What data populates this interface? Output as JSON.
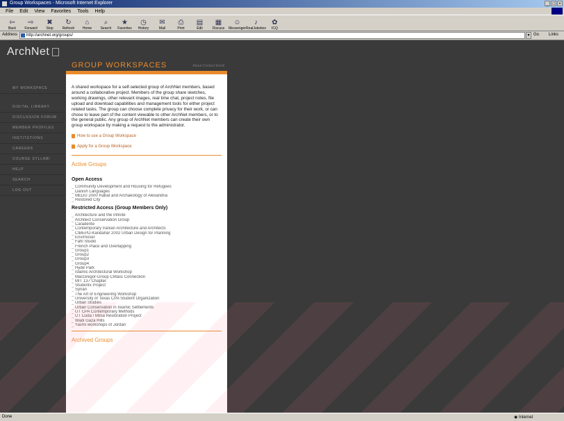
{
  "window": {
    "title": "Group Workspaces - Microsoft Internet Explorer",
    "menus": [
      "File",
      "Edit",
      "View",
      "Favorites",
      "Tools",
      "Help"
    ]
  },
  "toolbar": {
    "buttons": [
      {
        "label": "Back",
        "icon": "back-arrow-icon"
      },
      {
        "label": "Forward",
        "icon": "forward-arrow-icon"
      },
      {
        "label": "Stop",
        "icon": "stop-icon"
      },
      {
        "label": "Refresh",
        "icon": "refresh-icon"
      },
      {
        "label": "Home",
        "icon": "home-icon"
      },
      {
        "label": "Search",
        "icon": "search-icon"
      },
      {
        "label": "Favorites",
        "icon": "favorites-icon"
      },
      {
        "label": "History",
        "icon": "history-icon"
      },
      {
        "label": "Mail",
        "icon": "mail-icon"
      },
      {
        "label": "Print",
        "icon": "print-icon"
      },
      {
        "label": "Edit",
        "icon": "edit-icon"
      },
      {
        "label": "Discuss",
        "icon": "discuss-icon"
      },
      {
        "label": "Messenger",
        "icon": "messenger-icon"
      },
      {
        "label": "RealJukebox",
        "icon": "realjukebox-icon"
      },
      {
        "label": "ICQ",
        "icon": "icq-icon"
      }
    ]
  },
  "address": {
    "label": "Address",
    "url": "http://archnet.org/groups/",
    "go": "Go",
    "links": "Links"
  },
  "site": {
    "logo": "ArchNet",
    "nav": [
      "MY WORKSPACE",
      "DIGITAL LIBRARY",
      "DISCUSSION FORUM",
      "MEMBER PROFILES",
      "INSTITUTIONS",
      "CAREERS",
      "COURSE SYLLABI",
      "HELP",
      "SEARCH",
      "LOG OUT"
    ]
  },
  "page": {
    "title": "GROUP WORKSPACES",
    "util_links": "About  Contact  Email",
    "intro": "A shared workspace for a self-selected group of ArchNet members, based around a collaborative project. Members of the group share sketches, working drawings, other relevant images, real time chat, project notes, file upload and download capabilities and management tools for either project related tasks. The group can choose complete privacy for their work, or can chose to leave part of the content viewable to other ArchNet members, or to the general public. Any group of ArchNet members can create their own group workspace by making a request to the administrator.",
    "link_how": "How to use a Group Workspace",
    "link_apply": "Apply for a Group Workspace",
    "active_heading": "Active Groups",
    "open_heading": "Open Access",
    "open_groups": [
      "Community Development and Housing for Refugees",
      "Danish Languages",
      "MEDU 2000 Rabat and Archaeology of Alexandria",
      "Restored City"
    ],
    "restricted_heading": "Restricted Access (Group Members Only)",
    "restricted_groups": [
      "Architecture and the Infinite",
      "Architect Conservation Group",
      "Caradente",
      "Contemporary Iranian Architecture and Architects",
      "CIBEPD-Kandahar 2002 Urban Design for Planning",
      "Envirnoser",
      "Fahl Studio",
      "French Place and Overlapping",
      "Group1",
      "Group2",
      "Group3",
      "Group4",
      "Hyde Park",
      "Islamic Architectural Workshop",
      "MacGregor-Group CMass Connection",
      "MIT 137 Chapter",
      "Studentx Project",
      "Syrian",
      "The Art of Engineering Workshop",
      "University of Texas CPA Student Organization",
      "Urban Studies",
      "Urban Conservation in Islamic Settlements",
      "UT CPA Contemporary Methods",
      "UT Cuda / Milsa Restoration Project",
      "Wadi Gaza Hills",
      "Yasmi workshops of Jordan"
    ],
    "archived_heading": "Archived Groups"
  },
  "status": {
    "left": "Done",
    "right": "Internet"
  },
  "colors": {
    "accent": "#e98b2c",
    "page_bg": "#3a3a3a",
    "content_bg": "#ffffff"
  }
}
